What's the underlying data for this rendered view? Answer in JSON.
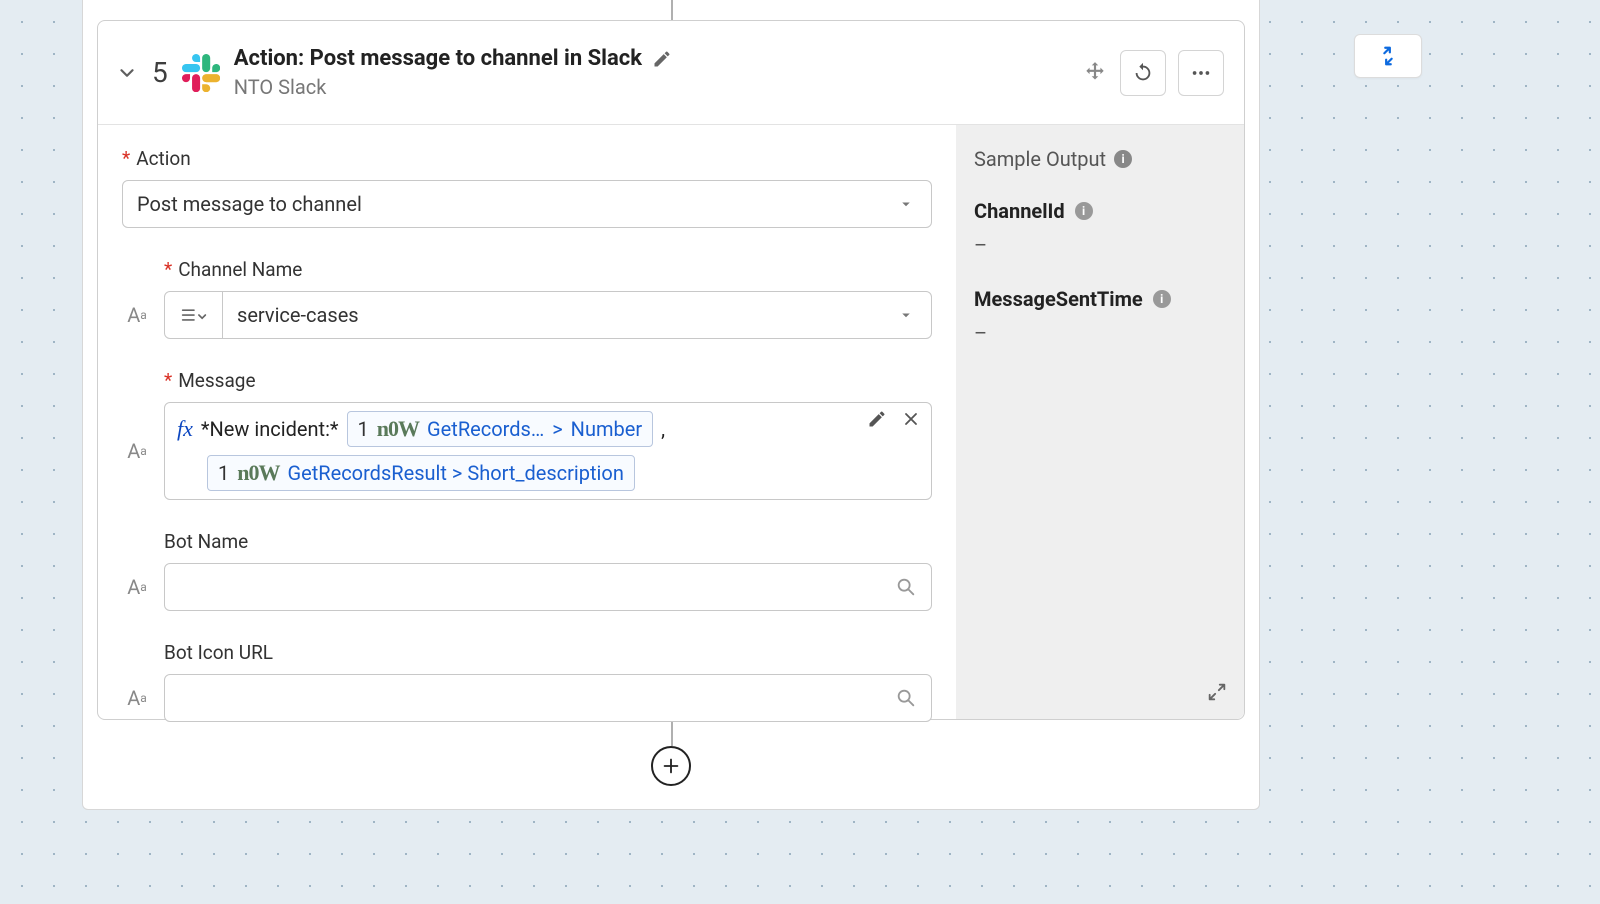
{
  "card": {
    "step_number": "5",
    "title": "Action: Post message to channel in Slack",
    "subtitle": "NTO Slack"
  },
  "form": {
    "action_label": "Action",
    "action_value": "Post message to channel",
    "channel_label": "Channel Name",
    "channel_value": "service-cases",
    "message_label": "Message",
    "message_prefix": "*New incident:*",
    "message_pill1_num": "1",
    "message_pill1_text": "GetRecords…",
    "message_pill1_caret": ">",
    "message_pill1_field": "Number",
    "message_comma": ",",
    "message_pill2_num": "1",
    "message_pill2_text": "GetRecordsResult > Short_description",
    "botname_label": "Bot Name",
    "botname_value": "",
    "boticon_label": "Bot Icon URL",
    "boticon_value": ""
  },
  "output": {
    "heading": "Sample Output",
    "channelid_label": "ChannelId",
    "channelid_value": "–",
    "msgtime_label": "MessageSentTime",
    "msgtime_value": "–"
  }
}
